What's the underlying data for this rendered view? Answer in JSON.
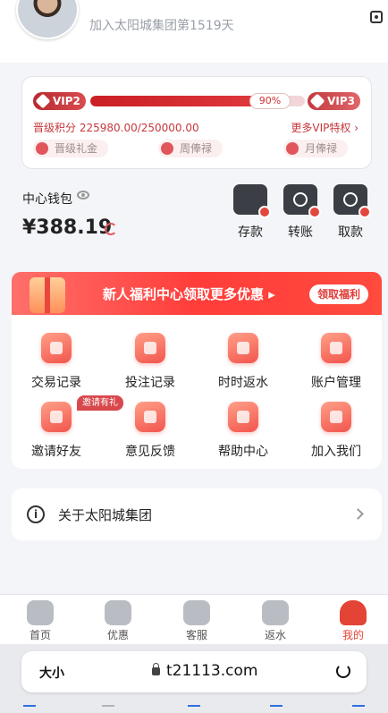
{
  "header": {
    "join_days": "加入太阳城集团第1519天"
  },
  "vip": {
    "current_level": "VIP2",
    "next_level": "VIP3",
    "progress_percent": "90%",
    "progress_fraction": 0.9,
    "points_text": "晋级积分 225980.00/250000.00",
    "more_link": "更多VIP特权 ›",
    "perks": [
      "晋级礼金",
      "周俸禄",
      "月俸禄"
    ]
  },
  "wallet": {
    "label": "中心钱包",
    "balance": "¥388.19",
    "actions": [
      "存款",
      "转账",
      "取款"
    ]
  },
  "banner": {
    "text": "新人福利中心领取更多优惠 ▸",
    "button": "领取福利"
  },
  "grid": {
    "items": [
      "交易记录",
      "投注记录",
      "时时返水",
      "账户管理",
      "邀请好友",
      "意见反馈",
      "帮助中心",
      "加入我们"
    ],
    "invite_tag": "邀请有礼"
  },
  "about": {
    "label": "关于太阳城集团",
    "info_glyph": "i"
  },
  "tabbar": {
    "tabs": [
      "首页",
      "优惠",
      "客服",
      "返水",
      "我的"
    ],
    "active_index": 4
  },
  "browser": {
    "size_button": "大小",
    "url": "t21113.com"
  },
  "colors": {
    "accent": "#e13a36",
    "vip_red": "#c91f25",
    "text_muted": "#9aa0a8"
  }
}
